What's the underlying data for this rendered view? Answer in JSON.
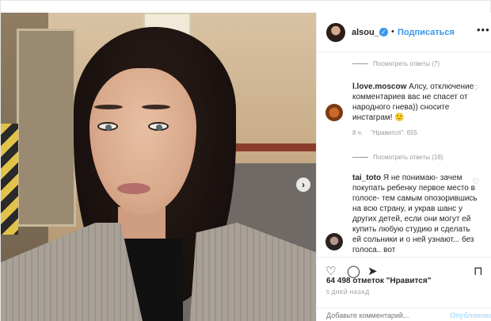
{
  "post": {
    "username": "alsou_a",
    "verified_icon": "verified-badge-icon",
    "separator": "•",
    "follow_label": "Подписаться",
    "more_label": "•••"
  },
  "comments": {
    "view_replies_1": "Посмотреть ответы (7)",
    "comment_1_user": "l.love.moscow",
    "comment_1_text": " Алсу, отключение комментариев вас не спасет от народного гнева)) сносите инстаграм! 🙂",
    "comment_1_time": "8 ч.",
    "comment_1_likes": "\"Нравится\": 655",
    "view_replies_2": "Посмотреть ответы (18)",
    "comment_2_user": "tai_toto",
    "comment_2_text": " Я не понимаю- зачем покупать ребенку первое место в голосе- тем самым опозорившись на всю страну, и украв шанс у других детей, если они могут ей купить любую студию и сделать ей сольники и о ней узнают... без голоса.. вот"
  },
  "actions": {
    "like_icon": "heart-icon",
    "comment_icon": "comment-icon",
    "share_icon": "share-icon",
    "save_icon": "bookmark-icon"
  },
  "likes_text": "64 498 отметок \"Нравится\"",
  "age_text": "5 ДНЕЙ НАЗАД",
  "add_comment_placeholder": "Добавьте комментарий...",
  "publish_label": "Опубликовать",
  "colors": {
    "accent": "#3897f0",
    "text": "#262626",
    "muted": "#999999",
    "publish_disabled": "#b2dffc"
  }
}
